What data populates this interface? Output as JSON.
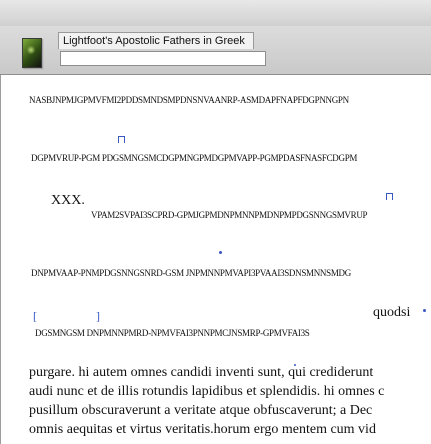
{
  "tab": {
    "title": "Lightfoot's Apostolic Fathers in Greek"
  },
  "address": {
    "value": ""
  },
  "content": {
    "garbled_1": "NASBJNPMJGPMVFMI2PDDSMNDSMPDNSNVAANRP-ASMDAPFNAPFDGPNNGPN",
    "garbled_2": "DGPMVRUP-PGM PDGSMNGSMCDGPMNGPMDGPMVAPP-PGMPDASFNASFCDGPM",
    "heading": "XXX.",
    "garbled_3": "VPAM2SVPAI3SCPRD-GPMJGPMDNPMNNPMDNPMPDGSNNGSMVRUP",
    "garbled_4": "DNPMVAAP-PNMPDGSNNGSNRD-GSM JNPMNNPMVAPI3PVAAI3SDNSMNNSMDG",
    "bracket_left": "[",
    "bracket_right": "]",
    "quodsi": "quodsi",
    "garbled_5": "DGSMNGSM DNPMNNPMRD-NPMVFAI3PNNPMCJNSMRP-GPMVFAI3S",
    "latin_1": "purgare. hi autem omnes candidi inventi sunt, qui crediderunt",
    "latin_2": "audi nunc et de illis rotundis lapidibus et splendidis. hi omnes c",
    "latin_3": "pusillum obscuraverunt a veritate atque obfuscaverunt; a Dec",
    "latin_4": "omnis aequitas et virtus veritatis.horum ergo mentem cum vid"
  }
}
